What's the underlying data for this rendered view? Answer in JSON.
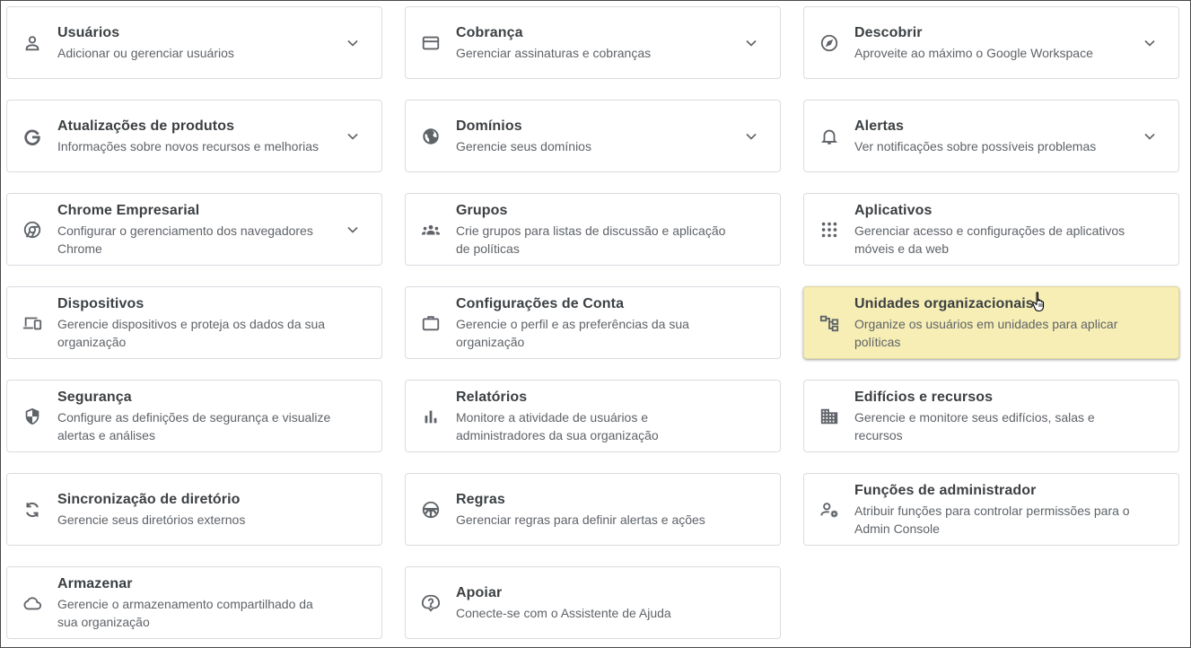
{
  "cards": {
    "usuarios": {
      "title": "Usuários",
      "desc": "Adicionar ou gerenciar usuários",
      "icon": "person-icon"
    },
    "cobranca": {
      "title": "Cobrança",
      "desc": "Gerenciar assinaturas e cobranças",
      "icon": "credit-card-icon"
    },
    "descobrir": {
      "title": "Descobrir",
      "desc": "Aproveite ao máximo o Google Workspace",
      "icon": "compass-icon"
    },
    "atualizacoes": {
      "title": "Atualizações de produtos",
      "desc": "Informações sobre novos recursos e melhorias",
      "icon": "google-g-icon"
    },
    "dominios": {
      "title": "Domínios",
      "desc": "Gerencie seus domínios",
      "icon": "globe-icon"
    },
    "alertas": {
      "title": "Alertas",
      "desc": "Ver notificações sobre possíveis problemas",
      "icon": "bell-icon"
    },
    "chrome": {
      "title": "Chrome Empresarial",
      "desc": "Configurar o gerenciamento dos navegadores Chrome",
      "icon": "chrome-icon"
    },
    "grupos": {
      "title": "Grupos",
      "desc": "Crie grupos para listas de discussão e aplicação de políticas",
      "icon": "groups-icon"
    },
    "aplicativos": {
      "title": "Aplicativos",
      "desc": "Gerenciar acesso e configurações de aplicativos móveis e da web",
      "icon": "apps-grid-icon"
    },
    "dispositivos": {
      "title": "Dispositivos",
      "desc": "Gerencie dispositivos e proteja os dados da sua organização",
      "icon": "devices-icon"
    },
    "conta": {
      "title": "Configurações de Conta",
      "desc": "Gerencie o perfil e as preferências da sua organização",
      "icon": "briefcase-icon"
    },
    "unidades": {
      "title": "Unidades organizacionais",
      "desc": "Organize os usuários em unidades para aplicar políticas",
      "icon": "org-units-icon"
    },
    "seguranca": {
      "title": "Segurança",
      "desc": "Configure as definições de segurança e visualize alertas e análises",
      "icon": "shield-icon"
    },
    "relatorios": {
      "title": "Relatórios",
      "desc": "Monitore a atividade de usuários e administradores da sua organização",
      "icon": "bar-chart-icon"
    },
    "edificios": {
      "title": "Edifícios e recursos",
      "desc": "Gerencie e monitore seus edifícios, salas e recursos",
      "icon": "building-icon"
    },
    "sincronizacao": {
      "title": "Sincronização de diretório",
      "desc": "Gerencie seus diretórios externos",
      "icon": "sync-icon"
    },
    "regras": {
      "title": "Regras",
      "desc": "Gerenciar regras para definir alertas e ações",
      "icon": "steering-wheel-icon"
    },
    "funcoes": {
      "title": "Funções de administrador",
      "desc": "Atribuir funções para controlar permissões para o Admin Console",
      "icon": "admin-roles-icon"
    },
    "armazenar": {
      "title": "Armazenar",
      "desc": "Gerencie o armazenamento compartilhado da sua organização",
      "icon": "cloud-icon"
    },
    "apoiar": {
      "title": "Apoiar",
      "desc": "Conecte-se com o Assistente de Ajuda",
      "icon": "help-icon"
    }
  },
  "colors": {
    "highlight": "#f6eeb5",
    "border": "#dadce0",
    "icon": "#5f6368",
    "title": "#3c4043"
  }
}
